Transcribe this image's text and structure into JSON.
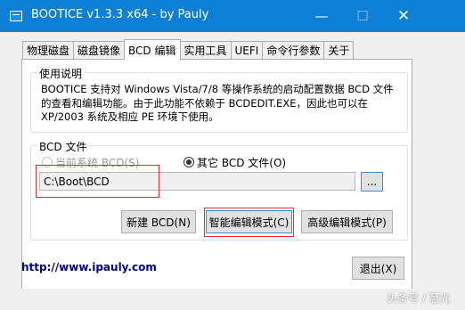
{
  "window": {
    "title": "BOOTICE v1.3.3 x64 - by Pauly",
    "minimize_glyph": "—",
    "maximize_glyph": "☐",
    "close_glyph": "✕"
  },
  "tabs": [
    {
      "label": "物理磁盘"
    },
    {
      "label": "磁盘镜像"
    },
    {
      "label": "BCD 编辑",
      "active": true
    },
    {
      "label": "实用工具"
    },
    {
      "label": "UEFI"
    },
    {
      "label": "命令行参数"
    },
    {
      "label": "关于"
    }
  ],
  "usage": {
    "title": "使用说明",
    "line1": "BOOTICE 支持对 Windows Vista/7/8 等操作系统的启动配置数据 BCD 文件",
    "line2": "的查看和编辑功能。由于此功能不依赖于 BCDEDIT.EXE，因此也可以在",
    "line3": "XP/2003 系统及相应 PE 环境下使用。"
  },
  "bcd": {
    "title": "BCD 文件",
    "radio_current": "当前系统 BCD(S)",
    "radio_other": "其它 BCD 文件(O)",
    "path_value": "C:\\Boot\\BCD",
    "browse_label": "..."
  },
  "buttons": {
    "new_bcd": "新建 BCD(N)",
    "smart_edit": "智能编辑模式(C)",
    "advanced_edit": "高级编辑模式(P)",
    "exit": "退出(X)"
  },
  "footer": {
    "url": "http://www.ipauly.com"
  },
  "watermark": "头条号 / 慧光",
  "colors": {
    "titlebar": "#0e7fd6",
    "highlight": "#e03030",
    "link": "#00008b"
  }
}
